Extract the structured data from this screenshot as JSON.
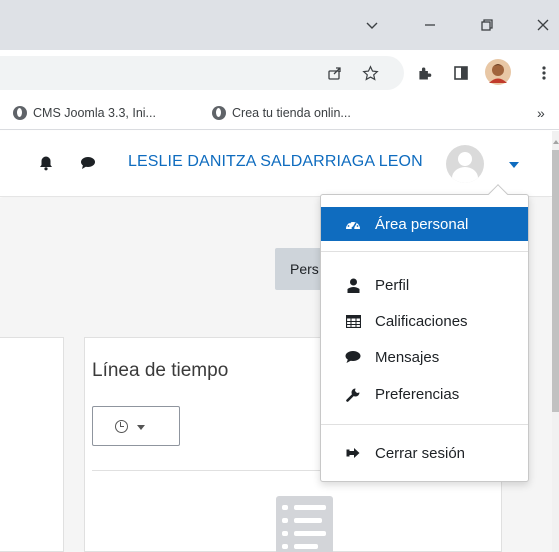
{
  "browser": {
    "window_controls": {
      "tabs_dropdown_icon": "chevron-down-icon",
      "minimize_icon": "minimize-icon",
      "restore_icon": "restore-icon",
      "close_icon": "close-icon"
    },
    "toolbar_icons": [
      "share-icon",
      "star-icon",
      "extensions-icon",
      "side-panel-icon",
      "profile-avatar",
      "more-vert-icon"
    ],
    "bookmarks": [
      {
        "label": "CMS Joomla 3.3, Ini...",
        "icon": "globe-icon"
      },
      {
        "label": "Crea tu tienda onlin...",
        "icon": "globe-icon"
      }
    ],
    "bookmarks_overflow": "»"
  },
  "navbar": {
    "user_name": "LESLIE DANITZA SALDARRIAGA LEON",
    "notifications_icon": "bell-icon",
    "messages_icon": "comment-icon",
    "accent": "#0f6cbf"
  },
  "user_menu": {
    "items": [
      {
        "label": "Área personal",
        "icon": "dashboard-icon",
        "active": true
      },
      {
        "label": "Perfil",
        "icon": "user-icon"
      },
      {
        "label": "Calificaciones",
        "icon": "table-icon"
      },
      {
        "label": "Mensajes",
        "icon": "comment-icon"
      },
      {
        "label": "Preferencias",
        "icon": "wrench-icon"
      },
      {
        "label": "Cerrar sesión",
        "icon": "sign-out-icon"
      }
    ]
  },
  "page": {
    "customize_button_partial": "Pers",
    "timeline": {
      "title": "Línea de tiempo",
      "filter_icon": "clock-icon"
    }
  }
}
